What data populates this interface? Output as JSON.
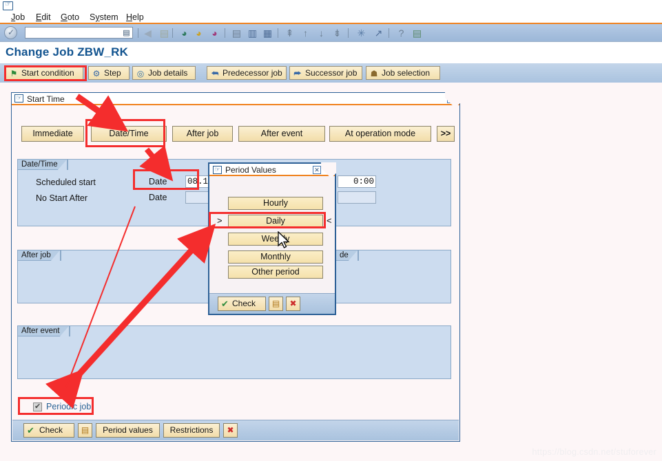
{
  "window": {
    "icon": "window-menu-icon"
  },
  "menubar": {
    "items": [
      {
        "label": "Job",
        "accel": "J"
      },
      {
        "label": "Edit",
        "accel": "E"
      },
      {
        "label": "Goto",
        "accel": "G"
      },
      {
        "label": "System",
        "accel": "y"
      },
      {
        "label": "Help",
        "accel": "H"
      }
    ]
  },
  "toolbar": {
    "ok_icon": "ok-check-icon",
    "command_field_value": "",
    "command_field_placeholder": "",
    "dropdown_icon": "command-field-dropdown-icon",
    "icons": [
      {
        "name": "back-icon",
        "glyph": "◀"
      },
      {
        "name": "save-icon",
        "glyph": "▤"
      },
      {
        "name": "exit-icon",
        "glyph": "◕"
      },
      {
        "name": "cancel-icon",
        "glyph": "◓"
      },
      {
        "name": "stop-icon",
        "glyph": "◒"
      },
      {
        "name": "print-icon",
        "glyph": "▤"
      },
      {
        "name": "find-icon",
        "glyph": "▥"
      },
      {
        "name": "find-next-icon",
        "glyph": "▦"
      },
      {
        "name": "first-page-icon",
        "glyph": "⇞"
      },
      {
        "name": "previous-page-icon",
        "glyph": "↑"
      },
      {
        "name": "next-page-icon",
        "glyph": "↓"
      },
      {
        "name": "last-page-icon",
        "glyph": "⇟"
      },
      {
        "name": "create-session-icon",
        "glyph": "✳"
      },
      {
        "name": "create-shortcut-icon",
        "glyph": "↗"
      },
      {
        "name": "help-icon",
        "glyph": "?"
      },
      {
        "name": "customize-icon",
        "glyph": "▤"
      }
    ]
  },
  "page": {
    "title": "Change Job ZBW_RK"
  },
  "tabstrip": {
    "buttons": [
      {
        "label": "Start condition",
        "icon": "flag-icon",
        "glyph": "⚑"
      },
      {
        "label": "Step",
        "icon": "step-icon",
        "glyph": "⚙"
      },
      {
        "label": "Job details",
        "icon": "magnifier-icon",
        "glyph": "🔍"
      },
      {
        "label": "Predecessor job",
        "icon": "predecessor-icon",
        "glyph": "⮪"
      },
      {
        "label": "Successor job",
        "icon": "successor-icon",
        "glyph": "⮫"
      },
      {
        "label": "Job selection",
        "icon": "person-icon",
        "glyph": "👤"
      }
    ]
  },
  "start_time_panel": {
    "title": "Start Time",
    "title_icon": "dialog-icon",
    "close_icon": "close-icon",
    "start_type_buttons": [
      {
        "label": "Immediate"
      },
      {
        "label": "Date/Time"
      },
      {
        "label": "After job"
      },
      {
        "label": "After event"
      },
      {
        "label": "At operation mode"
      },
      {
        "label": ">>"
      }
    ],
    "datetime_group": {
      "legend": "Date/Time",
      "rows": [
        {
          "label": "Scheduled start",
          "date_label": "Date",
          "date_value": "08.1",
          "time_value": "0:00"
        },
        {
          "label": "No Start After",
          "date_label": "Date",
          "date_value": "",
          "time_value": ""
        }
      ]
    },
    "after_job_group": {
      "legend": "After job"
    },
    "op_mode_group": {
      "legend": "de"
    },
    "after_event_group": {
      "legend": "After event"
    },
    "periodic_job": {
      "label": "Periodic job",
      "checked": true
    },
    "footer_buttons": [
      {
        "label": "Check",
        "icon": "check-icon",
        "glyph": "✔"
      },
      {
        "label": "",
        "icon": "save-icon",
        "glyph": "▤"
      },
      {
        "label": "Period values",
        "icon": "",
        "glyph": ""
      },
      {
        "label": "Restrictions",
        "icon": "",
        "glyph": ""
      },
      {
        "label": "",
        "icon": "cancel-icon",
        "glyph": "✖"
      }
    ]
  },
  "period_values_dialog": {
    "title": "Period Values",
    "title_icon": "dialog-icon",
    "close_icon": "close-icon",
    "options": [
      {
        "label": "Hourly",
        "selected": false
      },
      {
        "label": "Daily",
        "selected": true
      },
      {
        "label": "Weekly",
        "selected": false
      },
      {
        "label": "Monthly",
        "selected": false
      },
      {
        "label": "Other period",
        "selected": false
      }
    ],
    "selection_marker_left": ">",
    "selection_marker_right": "<",
    "footer_buttons": [
      {
        "label": "Check",
        "icon": "check-icon",
        "glyph": "✔"
      },
      {
        "label": "",
        "icon": "save-icon",
        "glyph": "▤"
      },
      {
        "label": "",
        "icon": "cancel-icon",
        "glyph": "✖"
      }
    ]
  },
  "annotations": {
    "highlight_color": "#f42d2d",
    "boxes": [
      "start-condition-button",
      "date-time-button",
      "date-label-field",
      "daily-option",
      "periodic-job-checkbox"
    ]
  },
  "watermark": {
    "text": "https://blog.csdn.net/stuforever"
  }
}
